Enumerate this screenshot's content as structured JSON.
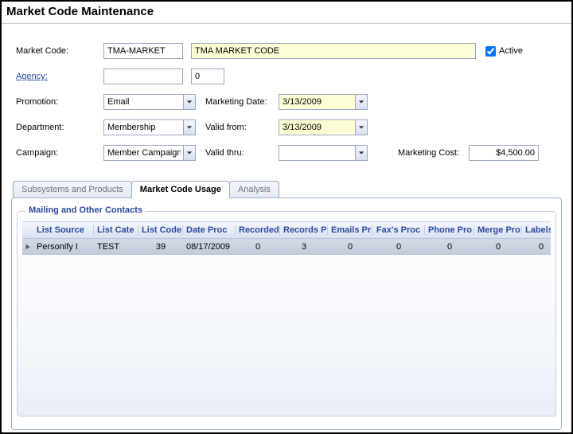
{
  "title": "Market Code Maintenance",
  "form": {
    "market_code": {
      "label": "Market Code:",
      "value": "TMA-MARKET",
      "description": "TMA MARKET CODE"
    },
    "active": {
      "label": "Active",
      "checked": true
    },
    "agency": {
      "label": "Agency:",
      "value": "",
      "code": "0"
    },
    "promotion": {
      "label": "Promotion:",
      "value": "Email"
    },
    "marketing_date": {
      "label": "Marketing Date:",
      "value": "3/13/2009"
    },
    "department": {
      "label": "Department:",
      "value": "Membership"
    },
    "valid_from": {
      "label": "Valid from:",
      "value": "3/13/2009"
    },
    "campaign": {
      "label": "Campaign:",
      "value": "Member Campaign"
    },
    "valid_thru": {
      "label": "Valid thru:",
      "value": ""
    },
    "marketing_cost": {
      "label": "Marketing Cost:",
      "value": "$4,500.00"
    }
  },
  "tabs": [
    {
      "label": "Subsystems and Products",
      "active": false
    },
    {
      "label": "Market Code Usage",
      "active": true
    },
    {
      "label": "Analysis",
      "active": false
    }
  ],
  "group_label": "Mailing and Other Contacts",
  "grid": {
    "columns": [
      "List Source",
      "List Cate",
      "List Code",
      "Date Proc",
      "Recorded",
      "Records P",
      "Emails Pr",
      "Fax's Proc",
      "Phone Pro",
      "Merge Pro",
      "Labels P"
    ],
    "rows": [
      {
        "list_source": "Personify I",
        "list_cate": "TEST",
        "list_code": "39",
        "date_proc": "08/17/2009",
        "recorded": "0",
        "records_p": "3",
        "emails_pr": "0",
        "faxs_proc": "0",
        "phone_pro": "0",
        "merge_pro": "0",
        "labels_p": "0"
      }
    ]
  }
}
